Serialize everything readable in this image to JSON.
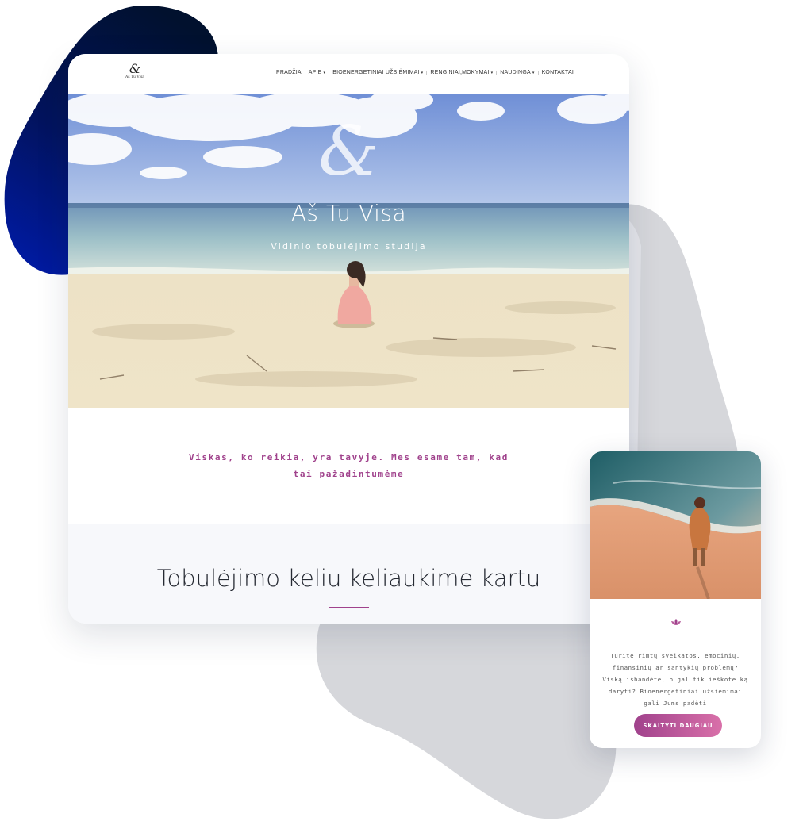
{
  "desktop": {
    "logo": {
      "mark": "&",
      "text": "Aš Tu Visa"
    },
    "nav": {
      "items": [
        {
          "label": "PRADŽIA",
          "dropdown": false
        },
        {
          "label": "APIE",
          "dropdown": true
        },
        {
          "label": "BIOENERGETINIAI UŽSIĖMIMAI",
          "dropdown": true
        },
        {
          "label": "RENGINIAI,MOKYMAI",
          "dropdown": true
        },
        {
          "label": "NAUDINGA",
          "dropdown": true
        },
        {
          "label": "KONTAKTAI",
          "dropdown": false
        }
      ],
      "caret": "▾"
    },
    "hero": {
      "mark": "&",
      "title": "Aš Tu Visa",
      "subtitle": "Vidinio tobulėjimo studija"
    },
    "intro": {
      "text": "Viskas, ko reikia, yra tavyje. Mes esame tam, kad tai pažadintumėme"
    },
    "section": {
      "title": "Tobulėjimo keliu keliaukime kartu"
    }
  },
  "mobile": {
    "icon": "lotus-icon",
    "text": "Turite rimtų sveikatos, emocinių, finansinių ar santykių problemų? Viską išbandėte, o gal tik ieškote ką daryti? Bioenergetiniai užsiėmimai gali Jums padėti",
    "button_label": "SKAITYTI DAUGIAU"
  },
  "colors": {
    "accent": "#a0428c",
    "accent_light": "#d970a9",
    "blob_dark": "#01112e",
    "blob_blue": "#001a9a",
    "blob_grey": "#d6d7db"
  }
}
